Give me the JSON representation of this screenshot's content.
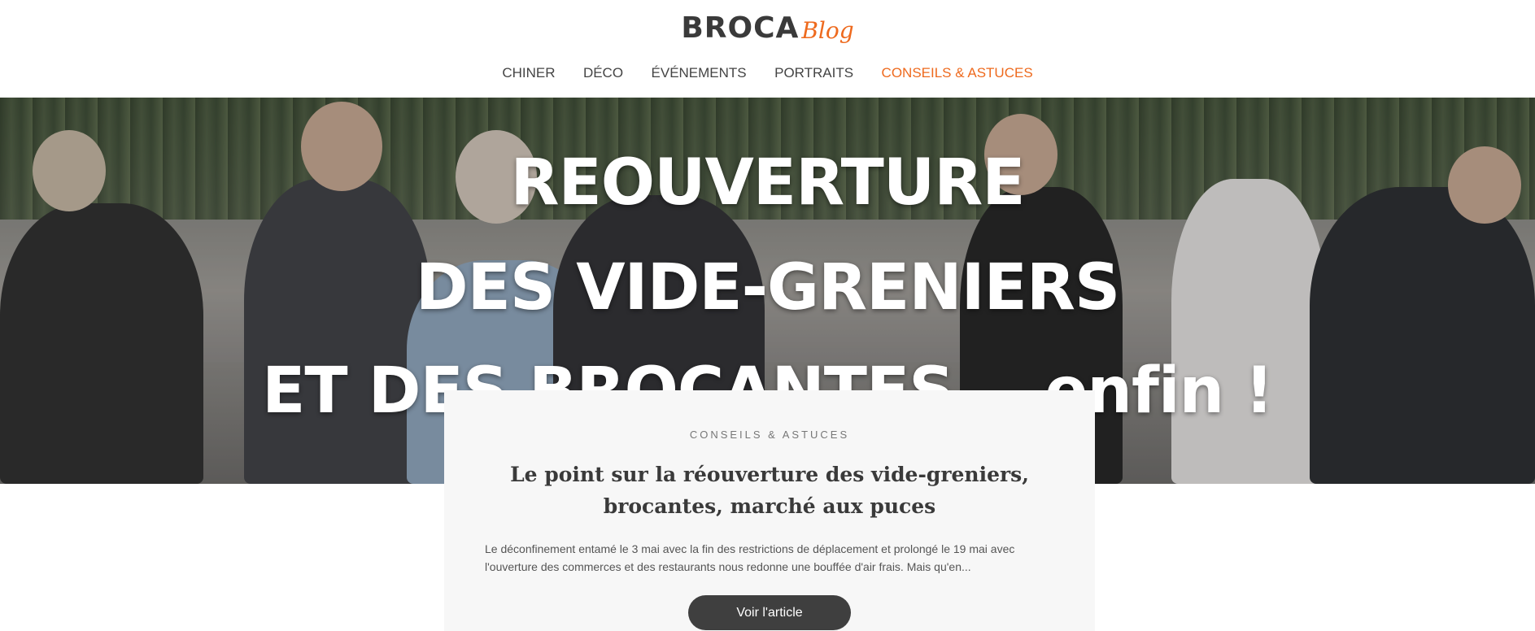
{
  "header": {
    "logo_main": "BROCA",
    "logo_script": "Blog"
  },
  "nav": {
    "items": [
      {
        "label": "CHINER"
      },
      {
        "label": "DÉCO"
      },
      {
        "label": "ÉVÉNEMENTS"
      },
      {
        "label": "PORTRAITS"
      },
      {
        "label": "CONSEILS & ASTUCES"
      }
    ],
    "active_index": 4
  },
  "hero": {
    "line1": "REOUVERTURE",
    "line2": "DES VIDE-GRENIERS",
    "line3": "ET DES BROCANTES... enfin !"
  },
  "article": {
    "category": "CONSEILS & ASTUCES",
    "title": "Le point sur la réouverture des vide-greniers, brocantes, marché aux puces",
    "excerpt": "Le déconfinement entamé le 3 mai avec la fin des restrictions de déplacement et prolongé le 19 mai avec l'ouverture des commerces et des restaurants nous redonne une bouffée d'air frais. Mais qu'en...",
    "button_label": "Voir l'article"
  },
  "colors": {
    "accent": "#ee6a1e",
    "button": "#3f3f3f",
    "card_bg": "#f7f7f7"
  }
}
